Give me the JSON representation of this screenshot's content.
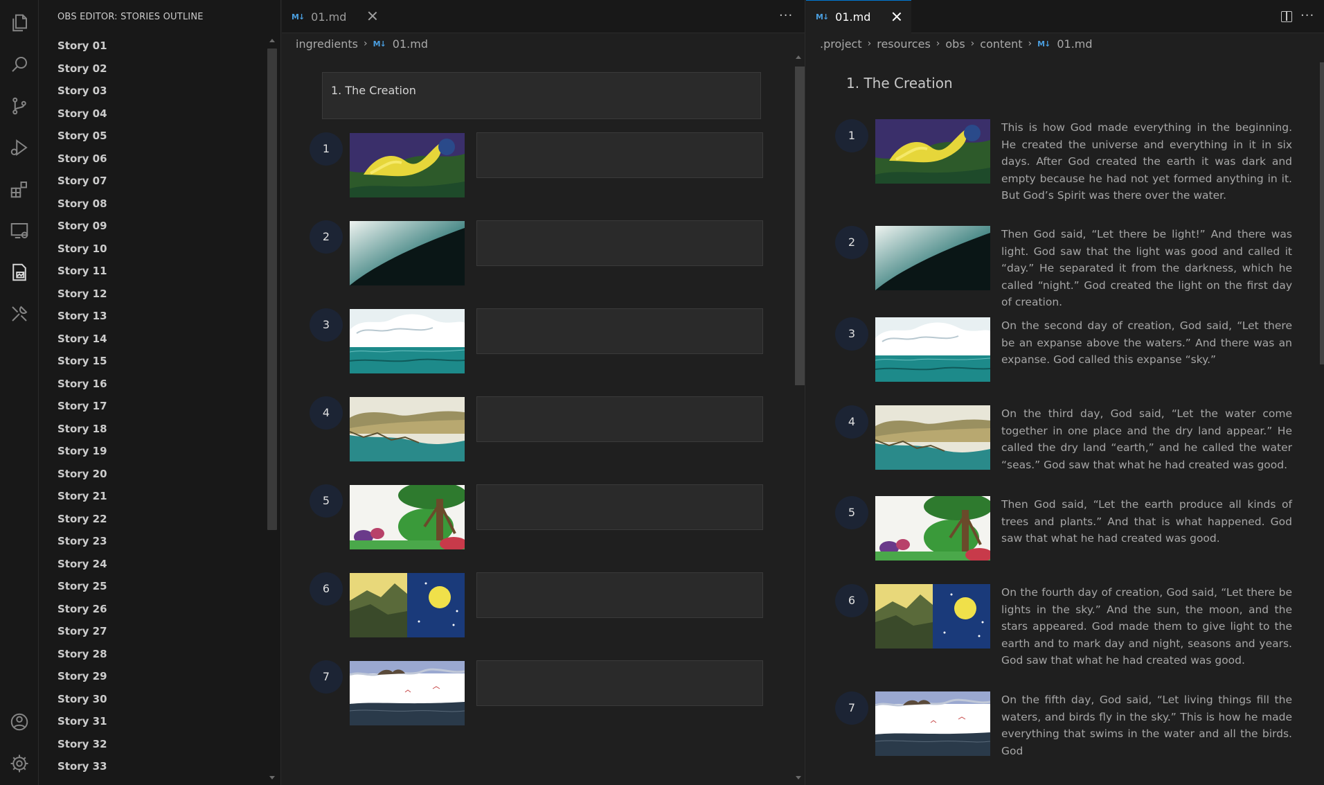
{
  "sidebar": {
    "title": "OBS EDITOR: STORIES OUTLINE",
    "stories": [
      "Story 01",
      "Story 02",
      "Story 03",
      "Story 04",
      "Story 05",
      "Story 06",
      "Story 07",
      "Story 08",
      "Story 09",
      "Story 10",
      "Story 11",
      "Story 12",
      "Story 13",
      "Story 14",
      "Story 15",
      "Story 16",
      "Story 17",
      "Story 18",
      "Story 19",
      "Story 20",
      "Story 21",
      "Story 22",
      "Story 23",
      "Story 24",
      "Story 25",
      "Story 26",
      "Story 27",
      "Story 28",
      "Story 29",
      "Story 30",
      "Story 31",
      "Story 32",
      "Story 33"
    ]
  },
  "activity_bar": {
    "icons": [
      "files-icon",
      "search-icon",
      "source-control-icon",
      "run-debug-icon",
      "extensions-icon",
      "remote-explorer-icon",
      "obs-editor-icon",
      "tools-icon",
      "account-icon",
      "settings-gear-icon"
    ]
  },
  "editor_left": {
    "tab": {
      "icon": "M↓",
      "label": "01.md"
    },
    "breadcrumb": [
      "ingredients",
      "01.md"
    ],
    "breadcrumb_icon": "M↓",
    "title_value": "1. The Creation",
    "frames": [
      "1",
      "2",
      "3",
      "4",
      "5",
      "6",
      "7"
    ]
  },
  "editor_right": {
    "tab": {
      "icon": "M↓",
      "label": "01.md"
    },
    "breadcrumb": [
      ".project",
      "resources",
      "obs",
      "content",
      "01.md"
    ],
    "breadcrumb_icon": "M↓",
    "title": "1. The Creation",
    "frames": [
      {
        "num": "1",
        "text": "This is how God made everything in the beginning. He created the universe and everything in it in six days. After God created the earth it was dark and empty because he had not yet formed anything in it. But God’s Spirit was there over the water."
      },
      {
        "num": "2",
        "text": "Then God said, “Let there be light!” And there was light. God saw that the light was good and called it “day.” He separated it from the darkness, which he called “night.” God created the light on the first day of creation."
      },
      {
        "num": "3",
        "text": "On the second day of creation, God said, “Let there be an expanse above the waters.” And there was an expanse. God called this expanse “sky.”"
      },
      {
        "num": "4",
        "text": "On the third day, God said, “Let the water come together in one place and the dry land appear.” He called the dry land “earth,” and he called the water “seas.” God saw that what he had created was good."
      },
      {
        "num": "5",
        "text": "Then God said, “Let the earth produce all kinds of trees and plants.” And that is what happened. God saw that what he had created was good."
      },
      {
        "num": "6",
        "text": "On the fourth day of creation, God said, “Let there be lights in the sky.” And the sun, the moon, and the stars appeared. God made them to give light to the earth and to mark day and night, seasons and years. God saw that what he had created was good."
      },
      {
        "num": "7",
        "text": "On the fifth day, God said, “Let living things fill the waters, and birds fly in the sky.” This is how he made everything that swims in the water and all the birds. God"
      }
    ]
  },
  "colors": {
    "background": "#1f1f1f",
    "sidebar": "#181818",
    "accent": "#0078d4",
    "markdown_icon": "#4a9edf",
    "frame_number_bg": "#1c2434"
  }
}
